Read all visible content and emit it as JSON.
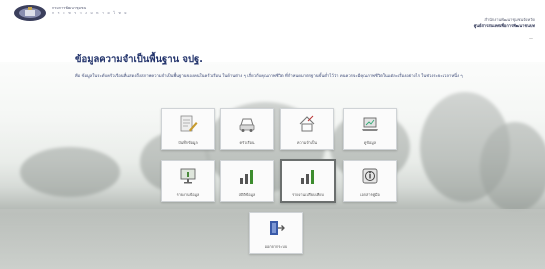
{
  "header": {
    "org_line_1": "กรมการพัฒนาชุมชน",
    "org_line_2": "ก ร ะ ท ร ว ง ม ห า ด ไ ท ย",
    "right_line_1": "สำนักงานพัฒนาชุมชนจังหวัด",
    "right_line_2": "ศูนย์สารสนเทศเพื่อการพัฒนาชนบท",
    "right_small": "—"
  },
  "main": {
    "title": "ข้อมูลความจำเป็นพื้นฐาน จปฐ.",
    "subtitle": "คือ ข้อมูลในระดับครัวเรือนที่แสดงถึงสภาพความจำเป็นพื้นฐานของคนในครัวเรือน ในด้านต่าง ๆ เกี่ยวกับคุณภาพชีวิต ที่กำหนดมาตรฐานขั้นต่ำไว้ว่า คนควรจะมีคุณภาพชีวิตในแต่ละเรื่องอย่างไร ในช่วงระยะเวลาหนึ่ง ๆ",
    "tiles": [
      {
        "label": "บันทึกข้อมูล",
        "icon": "edit-document-icon"
      },
      {
        "label": "ครัวเรือน",
        "icon": "car-icon"
      },
      {
        "label": "ความจำเป็น",
        "icon": "house-icon"
      },
      {
        "label": "ดูข้อมูล",
        "icon": "laptop-icon"
      },
      {
        "label": "รายงานข้อมูล",
        "icon": "monitor-icon"
      },
      {
        "label": "สถิติข้อมูล",
        "icon": "bar-chart-icon"
      },
      {
        "label": "รายงานเปรียบเทียบ",
        "icon": "bar-chart-icon"
      },
      {
        "label": "เอกสารคู่มือ",
        "icon": "info-icon"
      },
      {
        "label": "ออกจากระบบ",
        "icon": "logout-icon"
      }
    ]
  }
}
